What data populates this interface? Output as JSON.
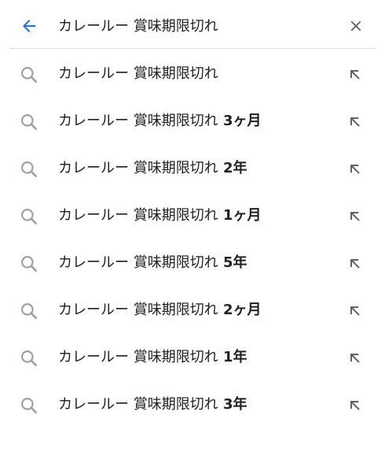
{
  "search": {
    "query": "カレールー 賞味期限切れ",
    "back_icon": "arrow-left-icon",
    "clear_icon": "close-icon",
    "accent_color": "#1a73e8"
  },
  "suggestions": [
    {
      "base": "カレールー 賞味期限切れ",
      "completion": ""
    },
    {
      "base": "カレールー 賞味期限切れ",
      "completion": "3ヶ月"
    },
    {
      "base": "カレールー 賞味期限切れ",
      "completion": "2年"
    },
    {
      "base": "カレールー 賞味期限切れ",
      "completion": "1ヶ月"
    },
    {
      "base": "カレールー 賞味期限切れ",
      "completion": "5年"
    },
    {
      "base": "カレールー 賞味期限切れ",
      "completion": "2ヶ月"
    },
    {
      "base": "カレールー 賞味期限切れ",
      "completion": "1年"
    },
    {
      "base": "カレールー 賞味期限切れ",
      "completion": "3年"
    }
  ],
  "icons": {
    "suggestion": "search-icon",
    "fill": "arrow-up-left-icon"
  }
}
